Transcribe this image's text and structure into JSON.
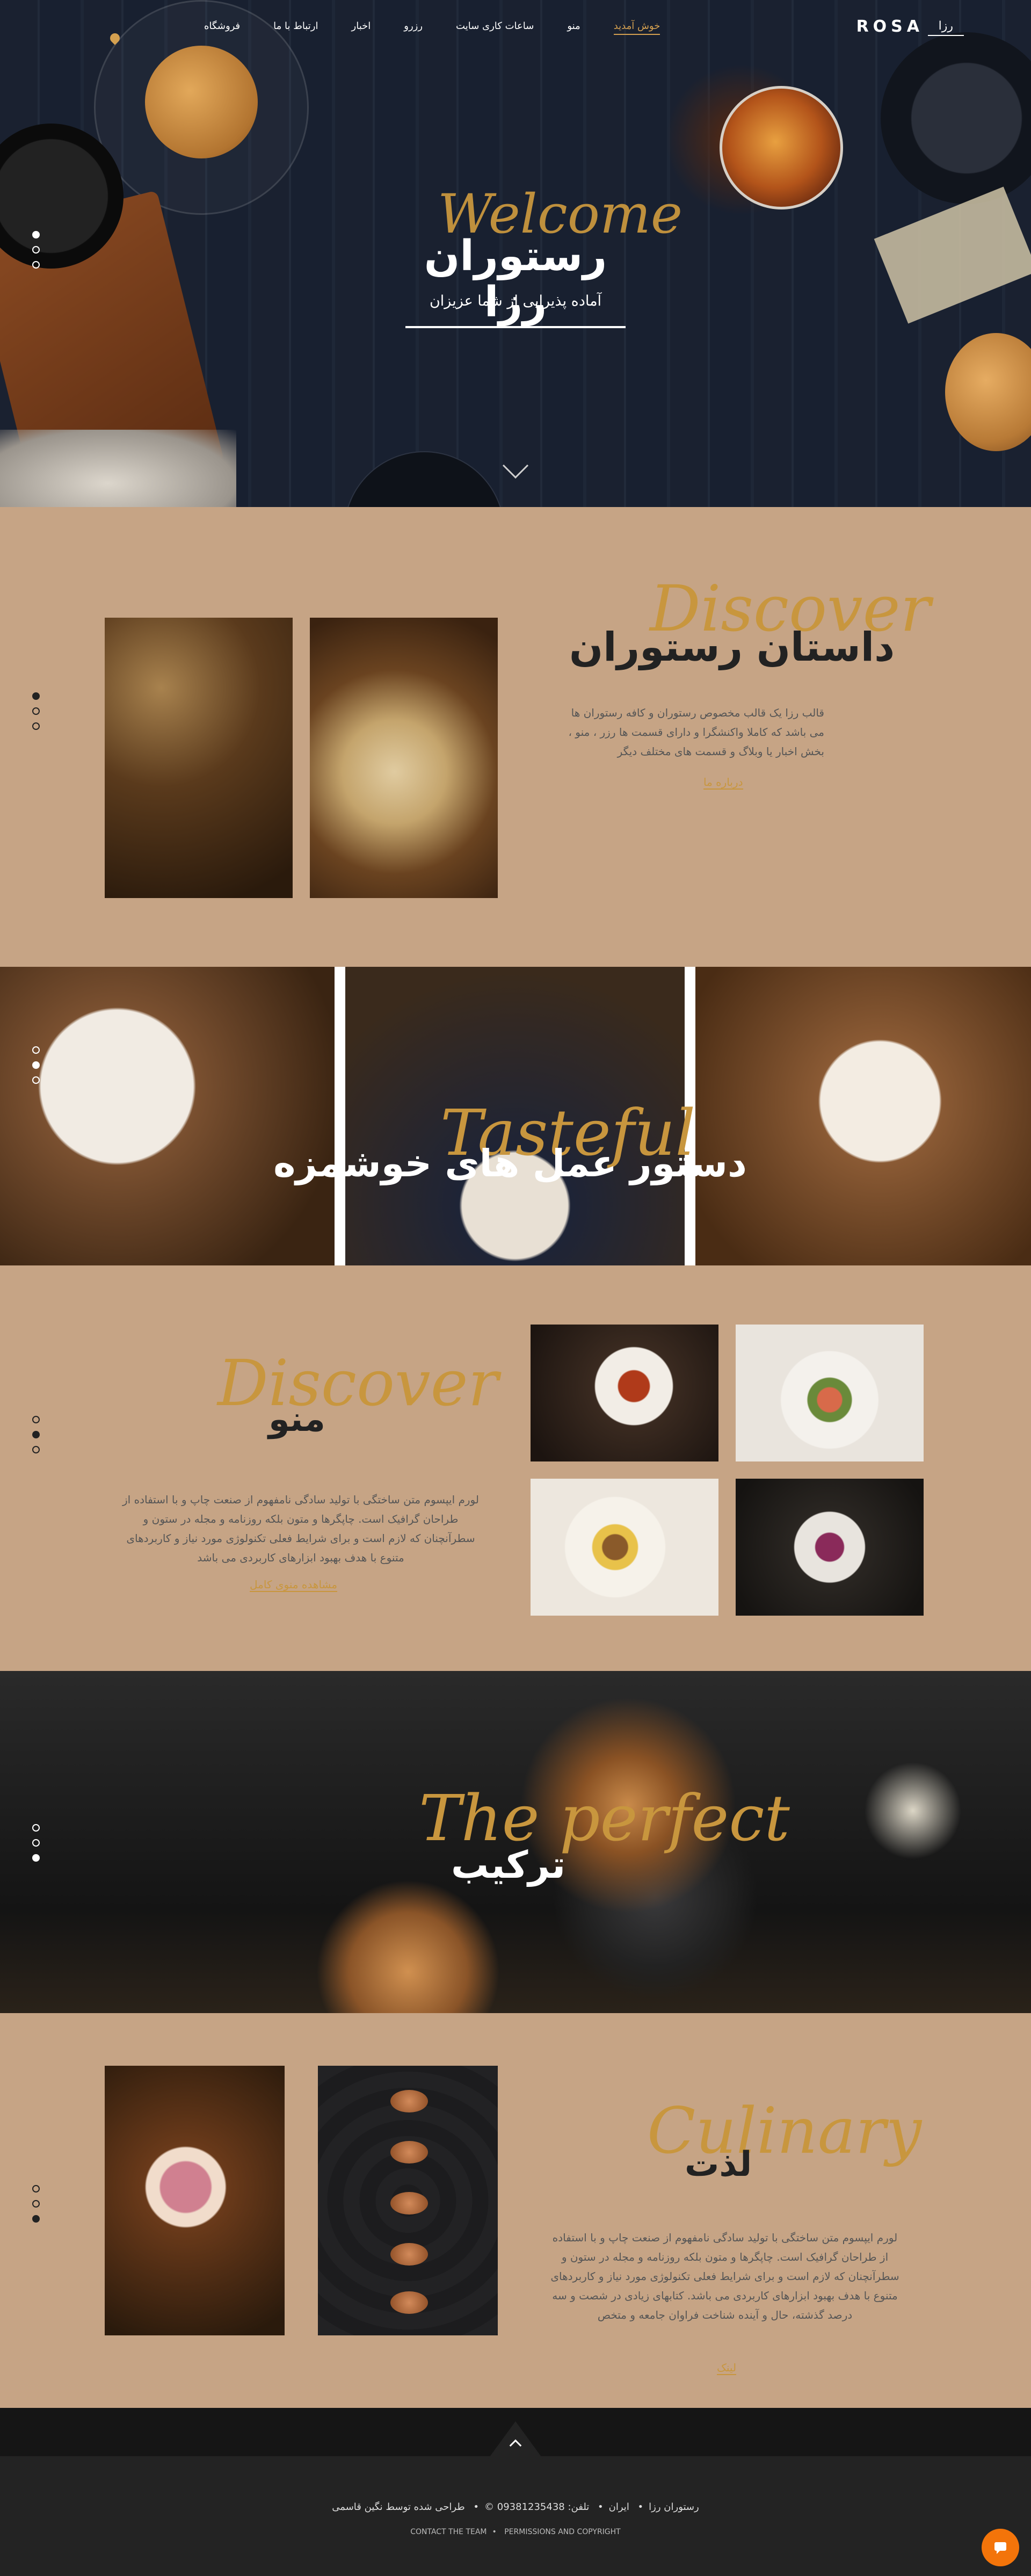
{
  "nav": {
    "logo": "ROSA",
    "logo_sub": "رزا",
    "items": [
      {
        "label": "خوش آمدید"
      },
      {
        "label": "منو"
      },
      {
        "label": "ساعات کاری سایت"
      },
      {
        "label": "رزرو"
      },
      {
        "label": "اخبار"
      },
      {
        "label": "ارتباط با ما"
      },
      {
        "label": "فروشگاه"
      }
    ]
  },
  "hero": {
    "script": "Welcome",
    "title": "رستوران رزا",
    "subtitle": "آماده پذیرایی از شما عزیزان"
  },
  "about": {
    "script": "Discover",
    "title": "داستان رستوران",
    "text": "قالب رزا یک قالب مخصوص رستوران و کافه رستوران ها می باشد که کاملا واکنشگرا و دارای قسمت ها رزر ، منو ، بخش اخبار یا وبلاگ و قسمت های مختلف دیگر",
    "link": "درباره ما"
  },
  "recipes": {
    "script": "Tasteful",
    "title": "دستور عمل های خوشمزه"
  },
  "menu": {
    "script": "Discover",
    "title": "منو",
    "text": "لورم ایپسوم متن ساختگی با تولید سادگی نامفهوم از صنعت چاپ و با استفاده از طراحان گرافیک است. چاپگرها و متون بلکه روزنامه و مجله در ستون و سطرآنچنان که لازم است و برای شرایط فعلی تکنولوژی مورد نیاز و کاربردهای متنوع با هدف بهبود ابزارهای کاربردی می باشد",
    "link": "مشاهده منوی کامل"
  },
  "perfect": {
    "script": "The perfect",
    "title": "ترکیب"
  },
  "culinary": {
    "script": "Culinary",
    "title": "لذت",
    "text": "لورم ایپسوم متن ساختگی با تولید سادگی نامفهوم از صنعت چاپ و با استفاده از طراحان گرافیک است. چاپگرها و متون بلکه روزنامه و مجله در ستون و سطرآنچنان که لازم است و برای شرایط فعلی تکنولوژی مورد نیاز و کاربردهای متنوع با هدف بهبود ابزارهای کاربردی می باشد. کتابهای زیادی در شصت و سه درصد گذشته، حال و آینده شناخت فراوان جامعه و متخص",
    "link": "لینک"
  },
  "footer": {
    "brand": "رستوران رزا",
    "country": "ایران",
    "phone": "تلفن: 09381235438 ©",
    "designer": "طراحی شده توسط نگین قاسمی",
    "team": "CONTACT THE TEAM",
    "rights": "PERMISSIONS AND COPYRIGHT"
  },
  "colors": {
    "accent": "#c8963e",
    "tan": "#c6a485",
    "dark": "#232323",
    "chat": "#f3740a"
  }
}
